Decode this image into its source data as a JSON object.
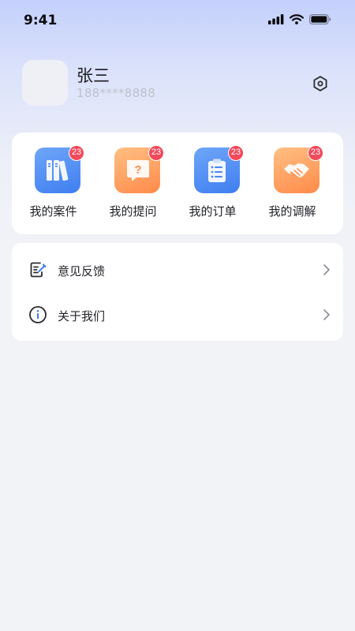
{
  "status_bar": {
    "time": "9:41",
    "icons": [
      "signal-icon",
      "wifi-icon",
      "battery-icon"
    ]
  },
  "profile": {
    "name": "张三",
    "phone": "188****8888",
    "settings_icon": "hexagon-settings-icon"
  },
  "quick_actions": [
    {
      "label": "我的案件",
      "badge": "23",
      "icon": "books-icon",
      "color": "#4a86f3"
    },
    {
      "label": "我的提问",
      "badge": "23",
      "icon": "question-chat-icon",
      "color": "#ff9a57"
    },
    {
      "label": "我的订单",
      "badge": "23",
      "icon": "clipboard-list-icon",
      "color": "#4a86f3"
    },
    {
      "label": "我的调解",
      "badge": "23",
      "icon": "handshake-icon",
      "color": "#ff9a57"
    }
  ],
  "menu": [
    {
      "label": "意见反馈",
      "icon": "feedback-edit-icon"
    },
    {
      "label": "关于我们",
      "icon": "info-circle-icon"
    }
  ],
  "colors": {
    "badge": "#f2495b",
    "blue_accent": "#4a86f3",
    "orange_accent": "#ff9a57",
    "background": "#f2f3f7"
  }
}
